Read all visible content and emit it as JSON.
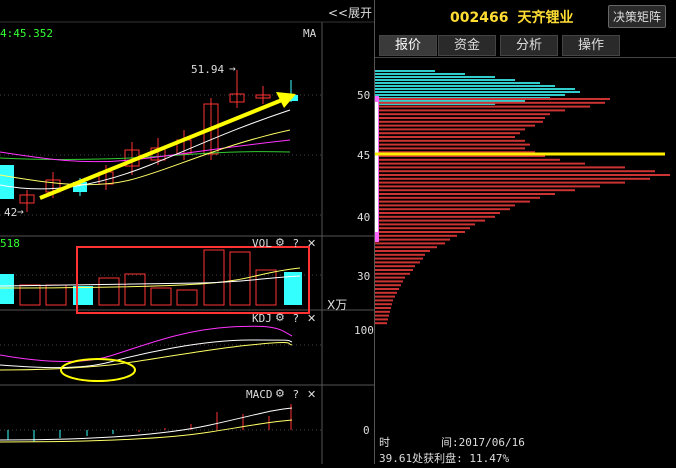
{
  "chart_header": {
    "price_readout": "4:45.352",
    "indicator": "MA",
    "expand_label": "<<展开"
  },
  "main_chart": {
    "high_label": "51.94",
    "low_label": "42"
  },
  "vol_panel": {
    "label": "VOL",
    "value_readout": "518",
    "unit": "X万",
    "settings_icon": "gear-icon",
    "help_label": "?",
    "close_label": "✕"
  },
  "kdj_panel": {
    "label": "KDJ",
    "help_label": "?",
    "close_label": "✕"
  },
  "macd_panel": {
    "label": "MACD",
    "help_label": "?",
    "close_label": "✕"
  },
  "right_panel": {
    "stock_code": "002466",
    "stock_name": "天齐锂业",
    "decision_button": "决策矩阵",
    "tabs": [
      "报价",
      "资金",
      "分析",
      "操作"
    ],
    "active_tab": 0
  },
  "price_axis": [
    "50",
    "45",
    "40",
    "30"
  ],
  "vol_axis_top": "100",
  "macd_axis_zero": "0",
  "footer": {
    "time_label": "时",
    "time_value": "间:2017/06/16",
    "profit_text": "39.61处获利盘: 11.47%"
  },
  "colors": {
    "up": "#ff3333",
    "down": "#33ffff",
    "ma_yellow": "#ffff00",
    "ma_white": "#ffffff",
    "ma_magenta": "#ff33ff",
    "ma_green": "#33cc33",
    "highlight_box": "#ff3333"
  }
}
